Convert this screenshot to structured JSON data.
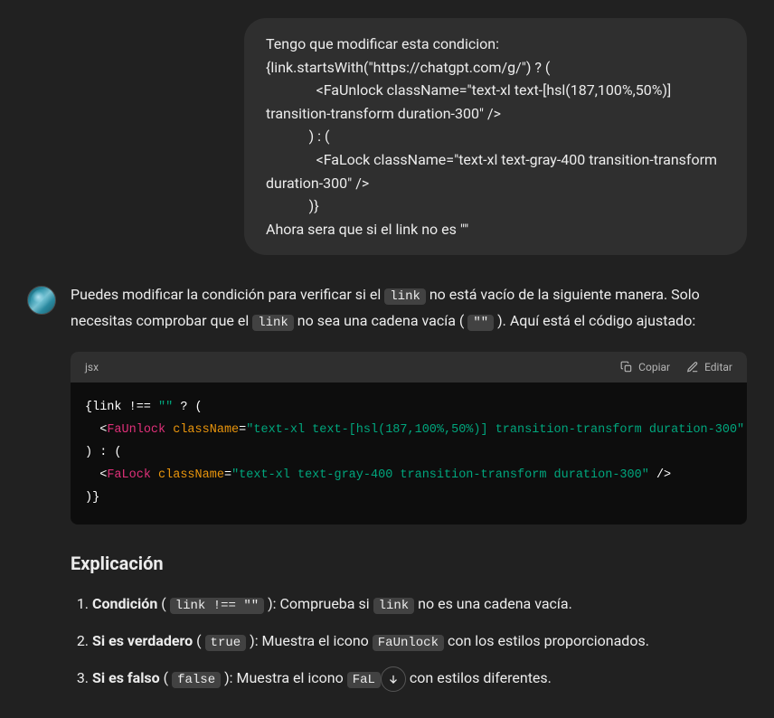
{
  "user_message": "Tengo que modificar esta condicion:\n{link.startsWith(\"https://chatgpt.com/g/\") ? (\n              <FaUnlock className=\"text-xl text-[hsl(187,100%,50%)] transition-transform duration-300\" />\n            ) : (\n              <FaLock className=\"text-xl text-gray-400 transition-transform duration-300\" />\n            )}\nAhora sera que si el link no es \"\"",
  "assistant": {
    "intro_p1": "Puedes modificar la condición para verificar si el ",
    "code1": "link",
    "intro_p2": " no está vacío de la siguiente manera. Solo necesitas comprobar que el ",
    "code2": "link",
    "intro_p3": " no sea una cadena vacía ( ",
    "code3": "\"\"",
    "intro_p4": " ). Aquí está el código ajustado:"
  },
  "code": {
    "lang": "jsx",
    "copy_label": "Copiar",
    "edit_label": "Editar",
    "line1": {
      "a": "{link !== ",
      "b": "\"\"",
      "c": " ? ("
    },
    "line2": {
      "a": "  <",
      "b": "FaUnlock",
      "c": " ",
      "d": "className",
      "e": "=",
      "f": "\"text-xl text-[hsl(187,100%,50%)] transition-transform duration-300\"",
      "g": " />"
    },
    "line3": ") : (",
    "line4": {
      "a": "  <",
      "b": "FaLock",
      "c": " ",
      "d": "className",
      "e": "=",
      "f": "\"text-xl text-gray-400 transition-transform duration-300\"",
      "g": " />"
    },
    "line5": ")}"
  },
  "explanation": {
    "heading": "Explicación",
    "item1": {
      "bold": "Condición",
      "paren_a": " ( ",
      "code_a": "link !== \"\"",
      "paren_b": " ): ",
      "t1": "Comprueba si ",
      "code_b": "link",
      "t2": " no es una cadena vacía."
    },
    "item2": {
      "bold": "Si es verdadero",
      "paren_a": " ( ",
      "code_a": "true",
      "paren_b": " ): ",
      "t1": "Muestra el icono ",
      "code_b": "FaUnlock",
      "t2": " con los estilos proporcionados."
    },
    "item3": {
      "bold": "Si es falso",
      "paren_a": " ( ",
      "code_a": "false",
      "paren_b": " ): ",
      "t1": "Muestra el icono ",
      "code_b": "FaL",
      "t2": " con estilos diferentes."
    }
  }
}
